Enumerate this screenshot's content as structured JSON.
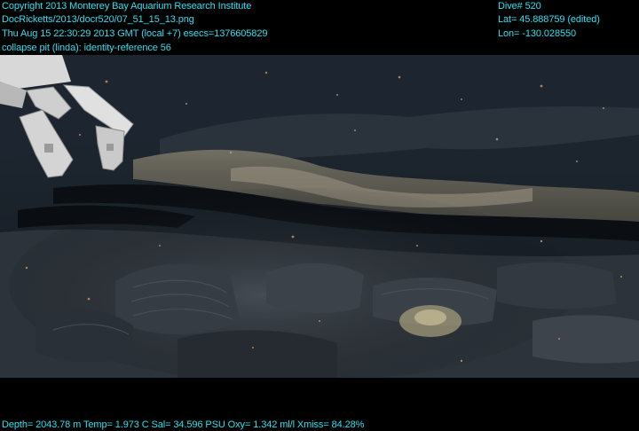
{
  "overlay": {
    "copyright": "Copyright 2013 Monterey Bay Aquarium Research Institute",
    "file_path": "DocRicketts/2013/docr520/07_51_15_13.png",
    "timestamp": "Thu Aug 15 22:30:29 2013 GMT (local +7)  esecs=1376605829",
    "annotation": "collapse pit (linda): identity-reference 56",
    "dive": "Dive# 520",
    "latitude": "Lat= 45.888759 (edited)",
    "longitude": "Lon= -130.028550",
    "telemetry": "Depth= 2043.78 m  Temp= 1.973 C  Sal= 34.596 PSU  Oxy= 1.342 ml/l  Xmiss= 84.28%"
  },
  "colors": {
    "overlay_text": "#2ee0f0",
    "background": "#000000",
    "seafloor_dark": "#1a2028",
    "seafloor_light": "#4a5058"
  },
  "scene": {
    "subject": "deep-sea collapse pit with basalt lava crust and ROV manipulator claw"
  }
}
